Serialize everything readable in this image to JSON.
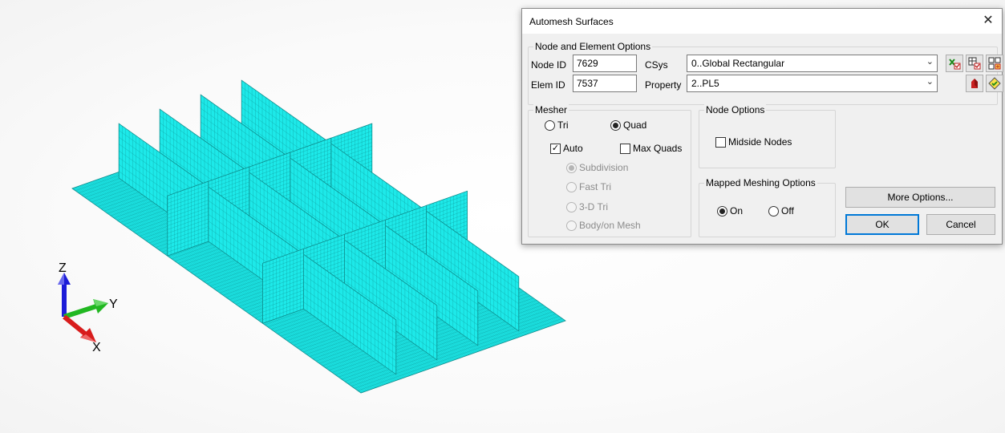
{
  "dialog": {
    "title": "Automesh Surfaces",
    "close_glyph": "✕",
    "node_element": {
      "group_label": "Node and Element Options",
      "node_id_label": "Node ID",
      "node_id_value": "7629",
      "elem_id_label": "Elem ID",
      "elem_id_value": "7537",
      "csys_label": "CSys",
      "csys_value": "0..Global Rectangular",
      "property_label": "Property",
      "property_value": "2..PL5"
    },
    "mesher": {
      "group_label": "Mesher",
      "tri": "Tri",
      "quad": "Quad",
      "selected": "Quad",
      "auto": "Auto",
      "auto_checked": true,
      "max_quads": "Max Quads",
      "max_quads_checked": false,
      "subdivision": "Subdivision",
      "fast_tri": "Fast Tri",
      "tri_3d": "3-D Tri",
      "body_on_mesh": "Body/on Mesh"
    },
    "node_options": {
      "group_label": "Node Options",
      "midside_nodes": "Midside Nodes",
      "midside_checked": false
    },
    "mapped": {
      "group_label": "Mapped Meshing Options",
      "on": "On",
      "off": "Off",
      "selected": "On"
    },
    "buttons": {
      "more_options": "More Options...",
      "ok": "OK",
      "cancel": "Cancel"
    }
  },
  "triad": {
    "z_label": "Z",
    "y_label": "Y",
    "x_label": "X",
    "colors": {
      "z": "#1c1cd8",
      "y": "#22b822",
      "x": "#d81c1c"
    }
  },
  "model": {
    "mesh_color": "#1de9e9",
    "line_color": "#0e8c8c"
  },
  "icons": {
    "csys_icons": [
      "select-csys-icon",
      "copy-csys-icon",
      "new-csys-icon"
    ],
    "property_icons": [
      "new-property-icon",
      "select-property-icon"
    ]
  }
}
